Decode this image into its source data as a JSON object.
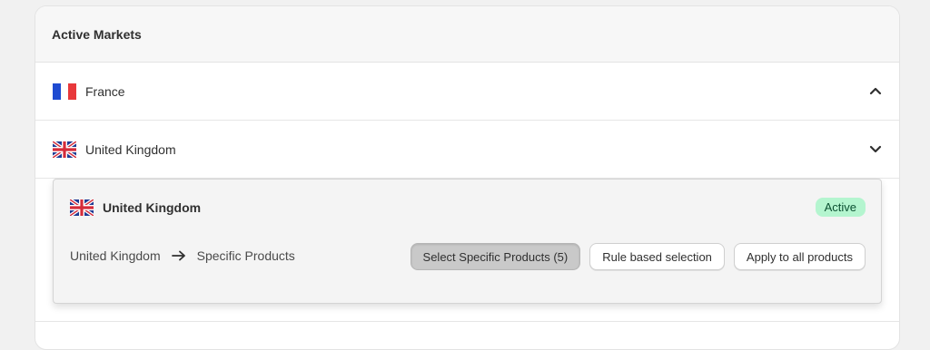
{
  "section": {
    "title": "Active Markets"
  },
  "markets": [
    {
      "name": "France",
      "expanded": true,
      "flag_icon": "france-flag-icon"
    },
    {
      "name": "United Kingdom",
      "expanded": false,
      "flag_icon": "uk-flag-icon"
    }
  ],
  "panel": {
    "title": "United Kingdom",
    "status": "Active",
    "path_from": "United Kingdom",
    "path_to": "Specific Products",
    "buttons": {
      "specific": "Select Specific Products (5)",
      "rule": "Rule based selection",
      "all": "Apply to all products"
    },
    "selected_button": "specific"
  },
  "colors": {
    "badge_bg": "#b4f5cf",
    "badge_text": "#0c5132",
    "selected_button_bg": "#c9c9c9"
  }
}
